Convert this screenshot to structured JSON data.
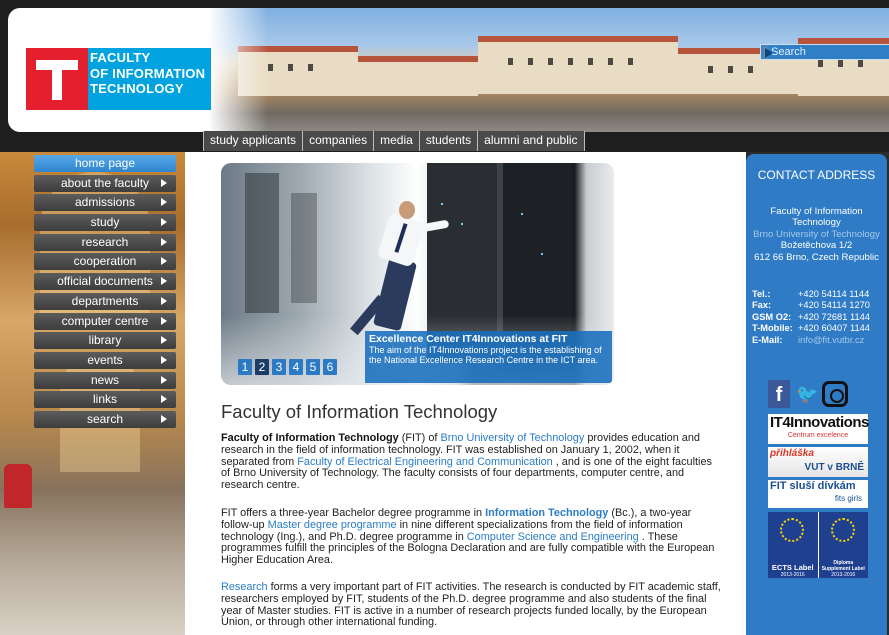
{
  "header": {
    "logo_lines": [
      "FACULTY",
      "OF INFORMATION",
      "TECHNOLOGY"
    ],
    "search_placeholder": "Search",
    "top_nav": [
      "study applicants",
      "companies",
      "media",
      "students",
      "alumni and public"
    ]
  },
  "left_menu": [
    {
      "label": "home page",
      "active": true,
      "arrow": false
    },
    {
      "label": "about the faculty",
      "active": false,
      "arrow": true
    },
    {
      "label": "admissions",
      "active": false,
      "arrow": true
    },
    {
      "label": "study",
      "active": false,
      "arrow": true
    },
    {
      "label": "research",
      "active": false,
      "arrow": true
    },
    {
      "label": "cooperation",
      "active": false,
      "arrow": true
    },
    {
      "label": "official documents",
      "active": false,
      "arrow": true
    },
    {
      "label": "departments",
      "active": false,
      "arrow": true
    },
    {
      "label": "computer centre",
      "active": false,
      "arrow": true
    },
    {
      "label": "library",
      "active": false,
      "arrow": true
    },
    {
      "label": "events",
      "active": false,
      "arrow": true
    },
    {
      "label": "news",
      "active": false,
      "arrow": true
    },
    {
      "label": "links",
      "active": false,
      "arrow": true
    },
    {
      "label": "search",
      "active": false,
      "arrow": true
    }
  ],
  "slider": {
    "caption_title": "Excellence Center IT4Innovations at FIT",
    "caption_text": "The aim of the IT4Innovations project is the establishing of the National Excellence Research Centre in the ICT area.",
    "pages": [
      "1",
      "2",
      "3",
      "4",
      "5",
      "6"
    ],
    "current_page": "2"
  },
  "main": {
    "title": "Faculty of Information Technology",
    "p1": {
      "b1": "Faculty of Information Technology",
      "t1": " (FIT) of ",
      "l1": "Brno University of Technology",
      "t2": " provides education and research in the field of information technology. FIT was established on January 1, 2002, when it separated from ",
      "l2": "Faculty of Electrical Engineering and Communication",
      "t3": " , and is one of the eight faculties of Brno University of Technology. The faculty consists of four departments, computer centre, and research centre."
    },
    "p2": {
      "t1": "FIT offers a three-year Bachelor degree programme in ",
      "l1": "Information Technology",
      "t2": " (Bc.), a two-year follow-up ",
      "l2": "Master degree programme",
      "t3": " in nine different specializations from the field of information technology (Ing.), and Ph.D. degree programme in ",
      "l3": "Computer Science and Engineering",
      "t4": " . These programmes fulfill the principles of the Bologna Declaration and are fully compatible with the European Higher Education Area."
    },
    "p3": {
      "l1": "Research",
      "t1": " forms a very important part of FIT activities. The research is conducted by FIT academic staff, researchers employed by FIT, students of the Ph.D. degree programme and also students of the final year of Master studies. FIT is active in a number of research projects funded locally, by the European Union, or through other international funding."
    }
  },
  "contact": {
    "title": "CONTACT ADDRESS",
    "addr_line1": "Faculty of Information",
    "addr_line2": "Technology",
    "addr_link": "Brno University of Technology",
    "addr_line3": "Božetěchova 1/2",
    "addr_line4": "612 66 Brno, Czech Republic",
    "phones": [
      {
        "label": "Tel.:",
        "value": "+420 54114 1144",
        "link": false
      },
      {
        "label": "Fax:",
        "value": "+420 54114 1270",
        "link": false
      },
      {
        "label": "GSM O2:",
        "value": "+420 72681 1144",
        "link": false
      },
      {
        "label": "T-Mobile:",
        "value": "+420 60407 1144",
        "link": false
      },
      {
        "label": "E-Mail:",
        "value": "info@fit.vutbr.cz",
        "link": true
      }
    ]
  },
  "badges": {
    "fb": "f",
    "it4i_big": "IT4Innovations",
    "it4i_small": "Centrum excelence",
    "vut_a": "přihláška",
    "vut_b": "VUT v BRNĚ",
    "fit_a": "FIT sluší dívkám",
    "fit_b": "fits girls",
    "ects_1": "ECTS Label",
    "ects_1_sub": "2013-2016",
    "ects_2": "Diploma Supplement Label",
    "ects_2_sub": "2013-2016"
  }
}
